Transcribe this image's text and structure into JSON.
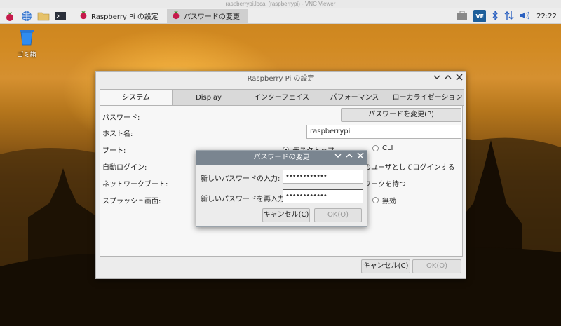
{
  "vnc_window_title": "raspberrypi.local (raspberrypi) - VNC Viewer",
  "taskbar": {
    "tasks": [
      {
        "label": "Raspberry Pi の設定",
        "active": false
      },
      {
        "label": "パスワードの変更",
        "active": true
      }
    ],
    "clock": "22:22",
    "ve_badge": "VE"
  },
  "desktop": {
    "trash_label": "ゴミ箱"
  },
  "settings_dialog": {
    "title": "Raspberry Pi の設定",
    "tabs": [
      "システム",
      "Display",
      "インターフェイス",
      "パフォーマンス",
      "ローカライゼーション"
    ],
    "labels": {
      "password": "パスワード:",
      "hostname": "ホスト名:",
      "boot": "ブート:",
      "autologin": "自動ログイン:",
      "network_boot": "ネットワークブート:",
      "splash": "スプラッシュ画面:"
    },
    "change_password_button": "パスワードを変更(P)",
    "hostname_value": "raspberrypi",
    "boot_options": [
      "デスクトップ",
      "CLI"
    ],
    "autologin_text": "のユーザとしてログインする",
    "network_boot_text": "ワークを待つ",
    "splash_off": "無効",
    "cancel_button": "キャンセル(C)",
    "ok_button": "OK(O)"
  },
  "password_dialog": {
    "title": "パスワードの変更",
    "new_password_label": "新しいパスワードの入力:",
    "new_password_value": "••••••••••••",
    "confirm_password_label": "新しいパスワードを再入力:",
    "confirm_password_value": "••••••••••••",
    "cancel_button": "キャンセル(C)",
    "ok_button": "OK(O)"
  }
}
